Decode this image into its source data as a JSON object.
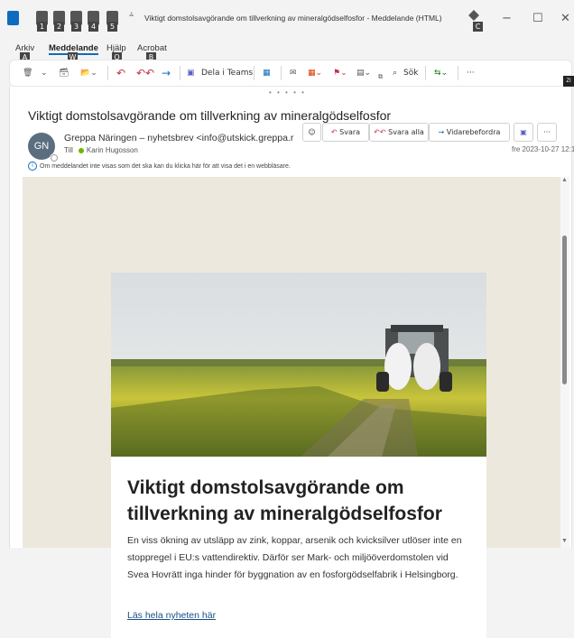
{
  "window": {
    "title": "Viktigt domstolsavgörande om tillverkning av mineralgödselfosfor  -  Meddelande (HTML)",
    "keytips": [
      "1",
      "2",
      "3",
      "4",
      "5"
    ],
    "keytip_c": "C",
    "minimize": "−",
    "maximize": "☐",
    "close": "✕"
  },
  "menu": {
    "items": [
      "Arkiv",
      "Meddelande",
      "Hjälp",
      "Acrobat"
    ],
    "keytips": [
      "A",
      "W",
      "Q",
      "B"
    ]
  },
  "ribbon": {
    "teams_label": "Dela i Teams",
    "search_label": "Sök",
    "more": "···",
    "keytip_zi": "ZI"
  },
  "message": {
    "subject": "Viktigt domstolsavgörande om tillverkning av mineralgödselfosfor",
    "avatar_initials": "GN",
    "sender": "Greppa Näringen – nyhetsbrev <info@utskick.greppa.r",
    "to_label": "Till",
    "recipient": "Karin Hugosson",
    "date": "fre 2023-10-27 12:19",
    "info": "Om meddelandet inte visas som det ska kan du klicka här för att visa det i en webbläsare.",
    "actions": {
      "reply": "Svara",
      "reply_all": "Svara alla",
      "forward": "Vidarebefordra",
      "more": "···"
    }
  },
  "newsletter": {
    "headline": "Viktigt domstolsavgörande om tillverkning av mineralgödselfosfor",
    "lead": "En viss ökning av utsläpp av zink, koppar, arsenik och kvicksilver utlöser inte en stoppregel i EU:s vattendirektiv. Därför ser Mark- och miljööverdomstolen vid Svea Hovrätt inga hinder för byggnation av en fosforgödselfabrik i Helsingborg.",
    "read_more": "Läs hela nyheten här"
  },
  "colors": {
    "accent": "#0f6cbd",
    "reply_red": "#c4314b",
    "teams_purple": "#5b5fc7",
    "body_bg": "#ede8dd"
  }
}
